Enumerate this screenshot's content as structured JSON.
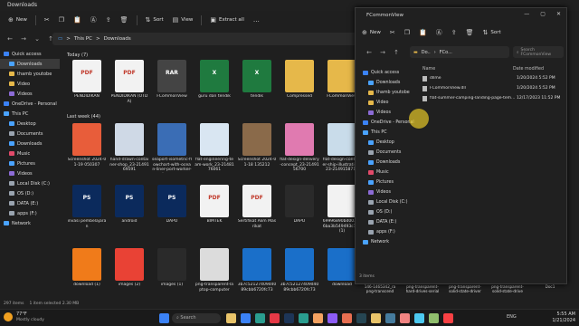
{
  "main_window": {
    "title": "Downloads",
    "commands": {
      "new": "New",
      "sort": "Sort",
      "view": "View",
      "extract_all": "Extract all"
    },
    "breadcrumb": {
      "root": "This PC",
      "sep": ">",
      "folder": "Downloads"
    },
    "sidebar": [
      {
        "label": "Quick access",
        "icon": "star-icon",
        "color": "#3b82f6",
        "selected": false
      },
      {
        "label": "Downloads",
        "icon": "download-icon",
        "color": "#4aa3ff",
        "selected": true
      },
      {
        "label": "thamb youtobe",
        "icon": "folder-icon",
        "color": "#e6b84a",
        "selected": false
      },
      {
        "label": "Video",
        "icon": "folder-icon",
        "color": "#e6b84a",
        "selected": false
      },
      {
        "label": "Videos",
        "icon": "video-icon",
        "color": "#8c6bd6",
        "selected": false
      },
      {
        "label": "OneDrive - Personal",
        "icon": "cloud-icon",
        "color": "#3b82f6",
        "selected": false
      },
      {
        "label": "This PC",
        "icon": "pc-icon",
        "color": "#4aa3ff",
        "selected": false
      },
      {
        "label": "Desktop",
        "icon": "desktop-icon",
        "color": "#4aa3ff",
        "selected": false
      },
      {
        "label": "Documents",
        "icon": "document-icon",
        "color": "#9aa4b0",
        "selected": false
      },
      {
        "label": "Downloads",
        "icon": "download-icon",
        "color": "#4aa3ff",
        "selected": false
      },
      {
        "label": "Music",
        "icon": "music-icon",
        "color": "#e24a6a",
        "selected": false
      },
      {
        "label": "Pictures",
        "icon": "pictures-icon",
        "color": "#4aa3ff",
        "selected": false
      },
      {
        "label": "Videos",
        "icon": "video-icon",
        "color": "#8c6bd6",
        "selected": false
      },
      {
        "label": "Local Disk (C:)",
        "icon": "disk-icon",
        "color": "#9aa4b0",
        "selected": false
      },
      {
        "label": "OS (D:)",
        "icon": "disk-icon",
        "color": "#9aa4b0",
        "selected": false
      },
      {
        "label": "DATA (E:)",
        "icon": "disk-icon",
        "color": "#9aa4b0",
        "selected": false
      },
      {
        "label": "apps (F:)",
        "icon": "disk-icon",
        "color": "#9aa4b0",
        "selected": false
      },
      {
        "label": "Network",
        "icon": "network-icon",
        "color": "#4aa3ff",
        "selected": false
      }
    ],
    "groups": {
      "today": "Today (7)",
      "last_week": "Last week (44)"
    },
    "today_files": [
      {
        "name": "PENDIDIKAN",
        "color": "#f2f2f2",
        "badge": "PDF"
      },
      {
        "name": "PENDIDIKAN (OTDA)",
        "color": "#f2f2f2",
        "badge": "PDF"
      },
      {
        "name": "FCommonView",
        "color": "#444",
        "badge": "RAR"
      },
      {
        "name": "guru dan tendik",
        "color": "#1f7a3f",
        "badge": "X"
      },
      {
        "name": "tendik",
        "color": "#1f7a3f",
        "badge": "X"
      },
      {
        "name": "Compressed",
        "color": "#e6b84a",
        "badge": ""
      },
      {
        "name": "FCommonView",
        "color": "#e6b84a",
        "badge": ""
      }
    ],
    "week_row1": [
      {
        "name": "Screenshot 2024-01-19 050307",
        "color": "#e85d3a"
      },
      {
        "name": "hand-drawn-container-shop_23-2149169591",
        "color": "#cfd9e6"
      },
      {
        "name": "seaport-isometric-flowchart-with-ocean-liner-port-worker-boom-c...",
        "color": "#3a6db5"
      },
      {
        "name": "flat-engineering-team-work_23-2148176061",
        "color": "#d9e6f2"
      },
      {
        "name": "Screenshot 2024-01-18 135212",
        "color": "#8a6a4a"
      },
      {
        "name": "flat-design-delivery-concept_23-2149156700",
        "color": "#e07ab0"
      },
      {
        "name": "flat-design-container-ship-illustration_23-2149158714",
        "color": "#c9dcea"
      }
    ],
    "week_row2": [
      {
        "name": "invasi pembelajaran",
        "color": "#0b2a5c",
        "badge": "PS"
      },
      {
        "name": "android",
        "color": "#0b2a5c",
        "badge": "PS"
      },
      {
        "name": "DAPO",
        "color": "#0b2a5c",
        "badge": "PS"
      },
      {
        "name": "BIMTEK",
        "color": "#f2f2f2",
        "badge": "PDF"
      },
      {
        "name": "Sertifikat Alim Masrikat",
        "color": "#f2f2f2",
        "badge": "PDF"
      },
      {
        "name": "DAPO",
        "color": "#2a2a2a",
        "badge": ""
      },
      {
        "name": "69996890bd0035c6ba3b549493c1a4 (1)",
        "color": "#f2f2f2",
        "badge": ""
      }
    ],
    "week_row3": [
      {
        "name": "download (1)",
        "color": "#f07b1a"
      },
      {
        "name": "images (2)",
        "color": "#e94235"
      },
      {
        "name": "images (1)",
        "color": "#2a2a2a"
      },
      {
        "name": "png-transparent-laptop-computer",
        "color": "#dcdcdc"
      },
      {
        "name": "3b7c52127409d4089cbb6720fc73",
        "color": "#1a6fc9"
      },
      {
        "name": "3b7c52127409d4089cbb6720fc73",
        "color": "#1a6fc9"
      },
      {
        "name": "download",
        "color": "#1a6fc9"
      }
    ],
    "status": {
      "count": "297 items",
      "selected": "1 item selected  2.30 MB"
    }
  },
  "fcv_window": {
    "title": "FCommonView",
    "commands": {
      "new": "New",
      "sort": "Sort"
    },
    "breadcrumb": {
      "a": "Do..",
      "b": "FCo..."
    },
    "search_placeholder": "Search FCommonView",
    "sidebar": [
      {
        "label": "Quick access",
        "icon": "star-icon",
        "color": "#3b82f6"
      },
      {
        "label": "Downloads",
        "icon": "download-icon",
        "color": "#4aa3ff"
      },
      {
        "label": "thamb youtobe",
        "icon": "folder-icon",
        "color": "#e6b84a"
      },
      {
        "label": "Video",
        "icon": "folder-icon",
        "color": "#e6b84a"
      },
      {
        "label": "Videos",
        "icon": "video-icon",
        "color": "#8c6bd6"
      },
      {
        "label": "OneDrive - Personal",
        "icon": "cloud-icon",
        "color": "#3b82f6"
      },
      {
        "label": "This PC",
        "icon": "pc-icon",
        "color": "#4aa3ff"
      },
      {
        "label": "Desktop",
        "icon": "desktop-icon",
        "color": "#4aa3ff"
      },
      {
        "label": "Documents",
        "icon": "document-icon",
        "color": "#9aa4b0"
      },
      {
        "label": "Downloads",
        "icon": "download-icon",
        "color": "#4aa3ff"
      },
      {
        "label": "Music",
        "icon": "music-icon",
        "color": "#e24a6a"
      },
      {
        "label": "Pictures",
        "icon": "pictures-icon",
        "color": "#4aa3ff"
      },
      {
        "label": "Videos",
        "icon": "video-icon",
        "color": "#8c6bd6"
      },
      {
        "label": "Local Disk (C:)",
        "icon": "disk-icon",
        "color": "#9aa4b0"
      },
      {
        "label": "OS (D:)",
        "icon": "disk-icon",
        "color": "#9aa4b0"
      },
      {
        "label": "DATA (E:)",
        "icon": "disk-icon",
        "color": "#9aa4b0"
      },
      {
        "label": "apps (F:)",
        "icon": "disk-icon",
        "color": "#9aa4b0"
      },
      {
        "label": "Network",
        "icon": "network-icon",
        "color": "#4aa3ff"
      }
    ],
    "columns": {
      "name": "Name",
      "date": "Date modified"
    },
    "files": [
      {
        "name": "dllme",
        "date": "1/20/2024 5:52 PM"
      },
      {
        "name": "FCommonView.dll",
        "date": "1/20/2024 5:52 PM"
      },
      {
        "name": "flat-summer-camping-landing-page-tem...",
        "date": "12/17/2023 11:52 PM"
      }
    ],
    "status": "3 items",
    "bottom_tiles": [
      "146-1465342_ra png-transcend",
      "png-transparent-hard-drives-serial",
      "png-transparent-solid-state-driver",
      "png-transparent-solid-state-drive",
      "Doc1"
    ]
  },
  "taskbar": {
    "weather_temp": "77°F",
    "weather_desc": "Mostly cloudy",
    "search_placeholder": "Search",
    "time": "5:55 AM",
    "date": "1/21/2024",
    "lang": "ENG"
  }
}
